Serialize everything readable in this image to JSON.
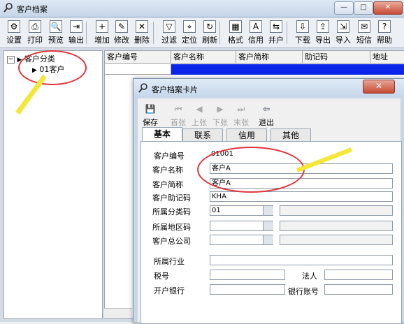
{
  "window": {
    "title": "客户档案"
  },
  "toolbar": {
    "items": [
      {
        "label": "设置",
        "icon": "settings-icon"
      },
      {
        "label": "打印",
        "icon": "printer-icon"
      },
      {
        "label": "预览",
        "icon": "preview-icon"
      },
      {
        "label": "输出",
        "icon": "export-icon"
      },
      {
        "label": "增加",
        "icon": "add-icon"
      },
      {
        "label": "修改",
        "icon": "edit-icon"
      },
      {
        "label": "删除",
        "icon": "delete-icon"
      },
      {
        "label": "过滤",
        "icon": "filter-icon"
      },
      {
        "label": "定位",
        "icon": "locate-icon"
      },
      {
        "label": "刷新",
        "icon": "refresh-icon"
      },
      {
        "label": "格式",
        "icon": "format-icon"
      },
      {
        "label": "信用",
        "icon": "credit-icon"
      },
      {
        "label": "并户",
        "icon": "merge-icon"
      },
      {
        "label": "下载",
        "icon": "download-icon"
      },
      {
        "label": "导出",
        "icon": "export-out-icon"
      },
      {
        "label": "导入",
        "icon": "import-icon"
      },
      {
        "label": "短信",
        "icon": "sms-icon"
      },
      {
        "label": "帮助",
        "icon": "help-icon"
      }
    ]
  },
  "tree": {
    "root": "客户分类",
    "child": "01客户"
  },
  "grid": {
    "columns": [
      "客户编号",
      "客户名称",
      "客户简称",
      "助记码",
      "地址"
    ]
  },
  "dialog": {
    "title": "客户档案卡片",
    "toolbar": [
      {
        "label": "保存",
        "enabled": true
      },
      {
        "label": "首张",
        "enabled": false
      },
      {
        "label": "上张",
        "enabled": false
      },
      {
        "label": "下张",
        "enabled": false
      },
      {
        "label": "末张",
        "enabled": false
      },
      {
        "label": "退出",
        "enabled": true
      }
    ],
    "tabs": [
      "基本",
      "联系",
      "信用",
      "其他"
    ],
    "active_tab": "基本",
    "fields": {
      "code": {
        "label": "客户编号",
        "value": "01001"
      },
      "name": {
        "label": "客户名称",
        "value": "客户A"
      },
      "short": {
        "label": "客户简称",
        "value": "客户A"
      },
      "mnemonic": {
        "label": "客户助记码",
        "value": "KHA"
      },
      "category": {
        "label": "所属分类码",
        "value": "01"
      },
      "region": {
        "label": "所属地区码",
        "value": ""
      },
      "parent": {
        "label": "客户总公司",
        "value": ""
      },
      "industry": {
        "label": "所属行业",
        "value": ""
      },
      "tax": {
        "label": "税号",
        "value": ""
      },
      "legal": {
        "label": "法人",
        "value": ""
      },
      "bank": {
        "label": "开户银行",
        "value": ""
      },
      "account": {
        "label": "银行账号",
        "value": ""
      }
    }
  },
  "colors": {
    "selection": "#0a24e8",
    "annotation": "#e0353c",
    "arrow": "#f5e63a"
  }
}
